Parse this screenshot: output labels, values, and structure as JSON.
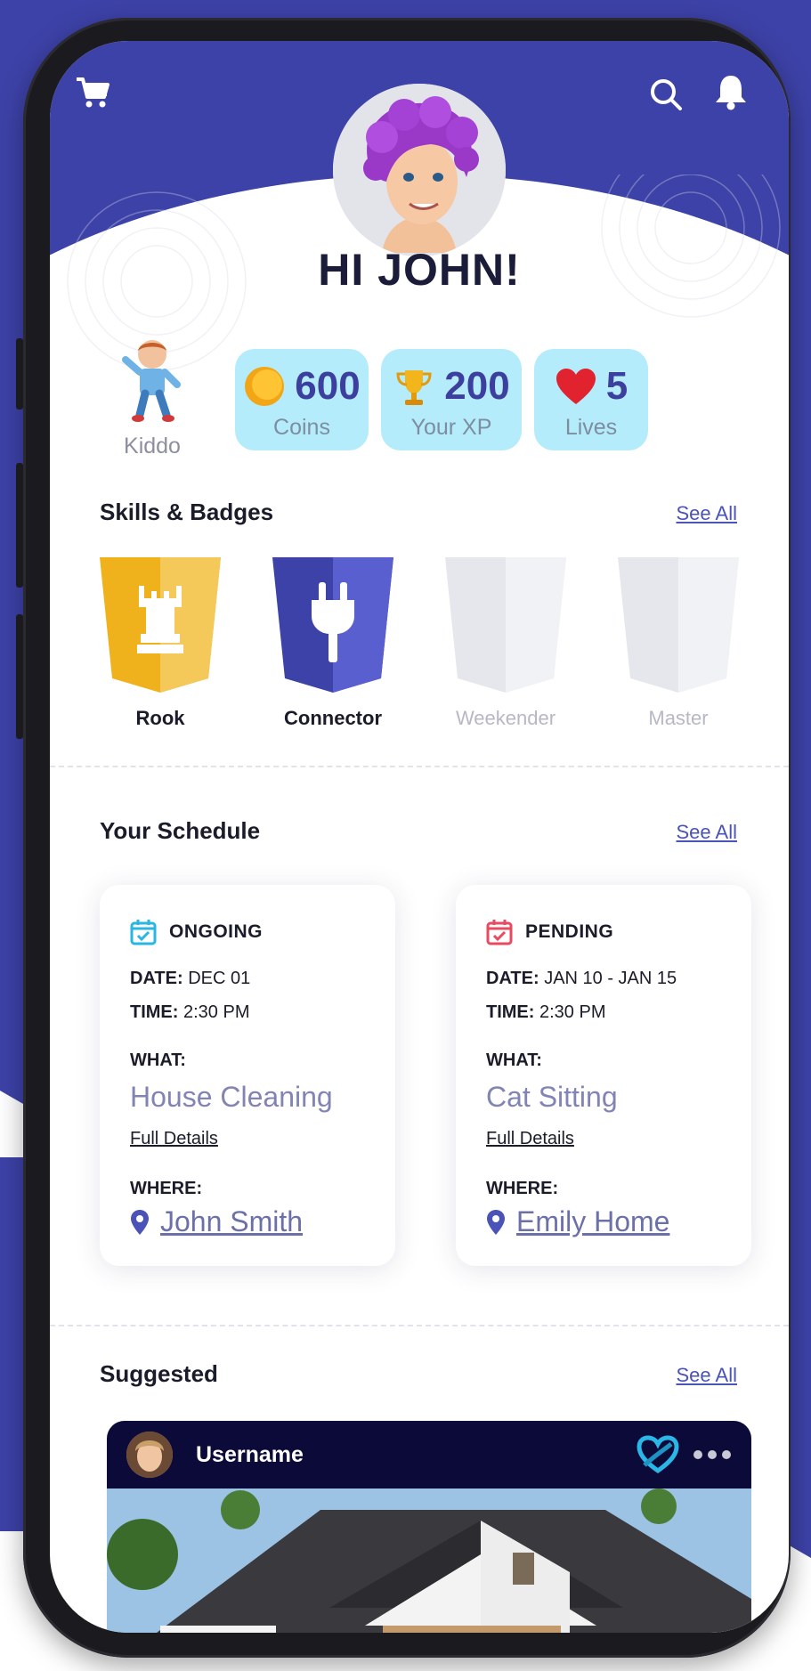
{
  "header": {
    "greeting": "HI JOHN!"
  },
  "profile": {
    "kiddo_label": "Kiddo"
  },
  "stats": [
    {
      "value": "600",
      "label": "Coins",
      "icon": "coin-icon"
    },
    {
      "value": "200",
      "label": "Your XP",
      "icon": "trophy-icon"
    },
    {
      "value": "5",
      "label": "Lives",
      "icon": "heart-icon"
    }
  ],
  "skills": {
    "title": "Skills & Badges",
    "see_all": "See All",
    "badges": [
      {
        "label": "Rook",
        "unlocked": true,
        "color": "#f0b21c",
        "icon": "rook-icon"
      },
      {
        "label": "Connector",
        "unlocked": true,
        "color": "#3d42a8",
        "icon": "plug-icon"
      },
      {
        "label": "Weekender",
        "unlocked": false,
        "color": "#e6e7ec"
      },
      {
        "label": "Master",
        "unlocked": false,
        "color": "#e6e7ec"
      }
    ]
  },
  "schedule": {
    "title": "Your Schedule",
    "see_all": "See All",
    "cards": [
      {
        "status": "ONGOING",
        "date_label": "DATE:",
        "date": "DEC 01",
        "time_label": "TIME:",
        "time": "2:30 PM",
        "what_label": "WHAT:",
        "what": "House Cleaning",
        "details": "Full Details",
        "where_label": "WHERE:",
        "where": "John Smith",
        "status_color": "#29b6e3"
      },
      {
        "status": "PENDING",
        "date_label": "DATE:",
        "date": "JAN 10 - JAN 15",
        "time_label": "TIME:",
        "time": "2:30 PM",
        "what_label": "WHAT:",
        "what": "Cat Sitting",
        "details": "Full Details",
        "where_label": "WHERE:",
        "where": "Emily Home",
        "status_color": "#e84a5f"
      }
    ]
  },
  "suggested": {
    "title": "Suggested",
    "see_all": "See All",
    "post": {
      "username": "Username"
    }
  },
  "colors": {
    "brand": "#3d42a8",
    "stat_bg": "#b4ecfb",
    "dark_bar": "#0c0a38"
  }
}
